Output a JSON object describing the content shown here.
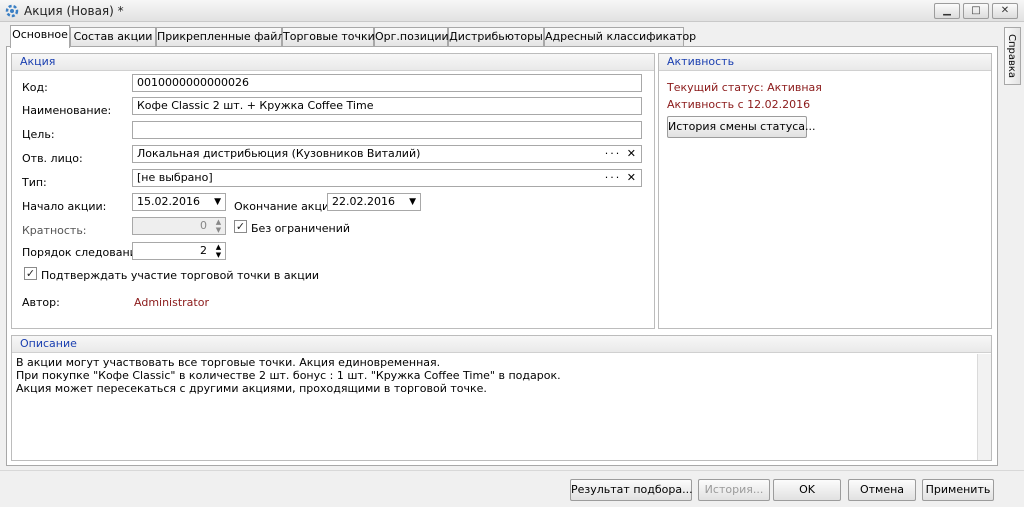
{
  "window": {
    "title": "Акция (Новая) *",
    "minimize": "▁",
    "maximize": "□",
    "close": "✕"
  },
  "tabs": [
    {
      "label": "Основное",
      "active": true
    },
    {
      "label": "Состав акции"
    },
    {
      "label": "Прикрепленные файлы"
    },
    {
      "label": "Торговые точки"
    },
    {
      "label": "Орг.позиции"
    },
    {
      "label": "Дистрибьюторы"
    },
    {
      "label": "Адресный классификатор"
    }
  ],
  "side_tab": "Справка",
  "action_group": {
    "caption": "Акция",
    "code_label": "Код:",
    "code_value": "0010000000000026",
    "name_label": "Наименование:",
    "name_value": "Кофе Classic 2 шт. + Кружка Coffee Time",
    "goal_label": "Цель:",
    "goal_value": "",
    "responsible_label": "Отв. лицо:",
    "responsible_value": "Локальная дистрибьюция (Кузовников Виталий)",
    "type_label": "Тип:",
    "type_value": "[не выбрано]",
    "start_label": "Начало акции:",
    "start_value": "15.02.2016",
    "end_label": "Окончание акции:",
    "end_value": "22.02.2016",
    "multiplicity_label": "Кратность:",
    "multiplicity_value": "0",
    "unlimited_label": "Без ограничений",
    "order_label": "Порядок следования:",
    "order_value": "2",
    "confirm_label": "Подтверждать участие торговой точки в акции",
    "author_label": "Автор:",
    "author_value": "Administrator",
    "dots": "···",
    "clear": "✕",
    "dropdown": "▼",
    "spin_up": "▲",
    "spin_down": "▼",
    "check": "✓"
  },
  "activity_group": {
    "caption": "Активность",
    "status_text": "Текущий статус: Активная",
    "active_since": "Активность с  12.02.2016",
    "history_button": "История смены статуса..."
  },
  "description_group": {
    "caption": "Описание",
    "text": "В акции могут участвовать все торговые точки. Акция единовременная.\nПри покупке \"Кофе Classic\" в количестве 2 шт. бонус : 1 шт. \"Кружка Coffee Time\" в подарок.\nАкция может пересекаться с другими акциями, проходящими в торговой точке."
  },
  "buttons": {
    "result": "Результат подбора...",
    "history": "История...",
    "ok": "OK",
    "cancel": "Отмена",
    "apply": "Применить"
  }
}
